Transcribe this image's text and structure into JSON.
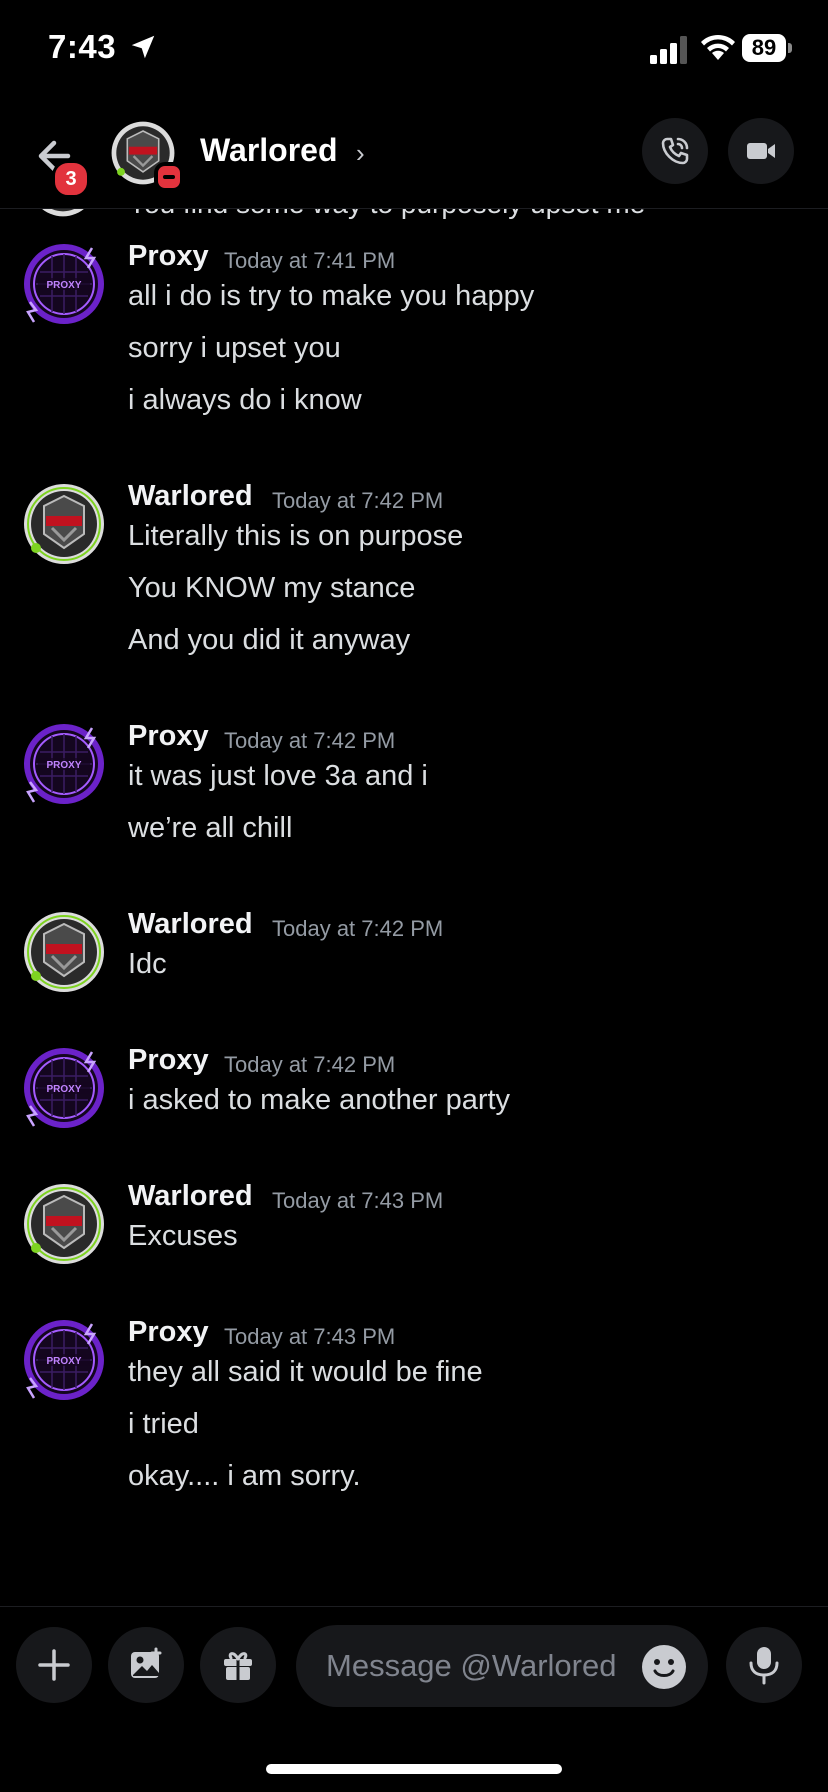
{
  "status_bar": {
    "time": "7:43",
    "battery": "89"
  },
  "header": {
    "back_badge": "3",
    "name": "Warlored",
    "chevron": "›"
  },
  "partial_message": "You find some way to purposely upset me",
  "messages": [
    {
      "author": "Proxy",
      "time": "Today at 7:41 PM",
      "avatar": "proxy-avatar",
      "lines": [
        "all i do is try to make you happy",
        "sorry i upset you",
        "i always do i know"
      ]
    },
    {
      "author": "Warlored",
      "time": "Today at 7:42 PM",
      "avatar": "warlored-avatar",
      "lines": [
        "Literally this is on purpose",
        "You KNOW my stance",
        "And you did it anyway"
      ]
    },
    {
      "author": "Proxy",
      "time": "Today at 7:42 PM",
      "avatar": "proxy-avatar",
      "lines": [
        "it was just love 3a and i",
        "we’re all chill"
      ]
    },
    {
      "author": "Warlored",
      "time": "Today at 7:42 PM",
      "avatar": "warlored-avatar",
      "lines": [
        "Idc"
      ]
    },
    {
      "author": "Proxy",
      "time": "Today at 7:42 PM",
      "avatar": "proxy-avatar",
      "lines": [
        "i asked to make another party"
      ]
    },
    {
      "author": "Warlored",
      "time": "Today at 7:43 PM",
      "avatar": "warlored-avatar",
      "lines": [
        "Excuses"
      ]
    },
    {
      "author": "Proxy",
      "time": "Today at 7:43 PM",
      "avatar": "proxy-avatar",
      "lines": [
        "they all said it would be fine",
        "i tried",
        "okay.... i am sorry."
      ]
    }
  ],
  "composer": {
    "placeholder": "Message @Warlored"
  },
  "colors": {
    "background": "#000000",
    "surface": "#17181b",
    "timestamp": "#949ba4",
    "badge": "#e2333d",
    "proxy_ring": "#8a3ee6",
    "warlored_ring": "#7ed321"
  }
}
